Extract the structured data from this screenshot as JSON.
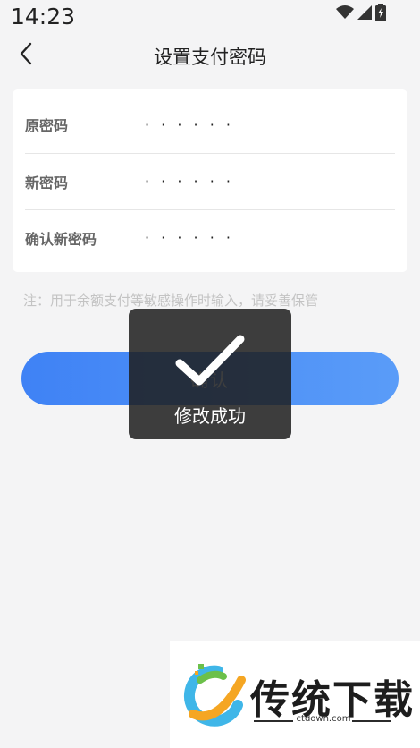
{
  "status_bar": {
    "time": "14:23",
    "icons": [
      "wifi-icon",
      "signal-icon",
      "battery-icon"
    ]
  },
  "nav": {
    "title": "设置支付密码",
    "back_icon": "chevron-left-icon"
  },
  "form": {
    "rows": [
      {
        "label": "原密码",
        "value": "· · · · · ·"
      },
      {
        "label": "新密码",
        "value": "· · · · · ·"
      },
      {
        "label": "确认新密码",
        "value": "· · · · · ·"
      }
    ]
  },
  "note": "注：用于余额支付等敏感操作时输入，请妥善保管",
  "confirm_button": {
    "label": "确认"
  },
  "toast": {
    "icon": "checkmark-icon",
    "text": "修改成功"
  },
  "watermark": {
    "title": "传统下载",
    "url": "ctdown.com"
  },
  "colors": {
    "primary": "#3f82f5",
    "primary_end": "#5a9cf8",
    "background": "#f4f4f5",
    "toast_bg": "#1e1e1e"
  }
}
